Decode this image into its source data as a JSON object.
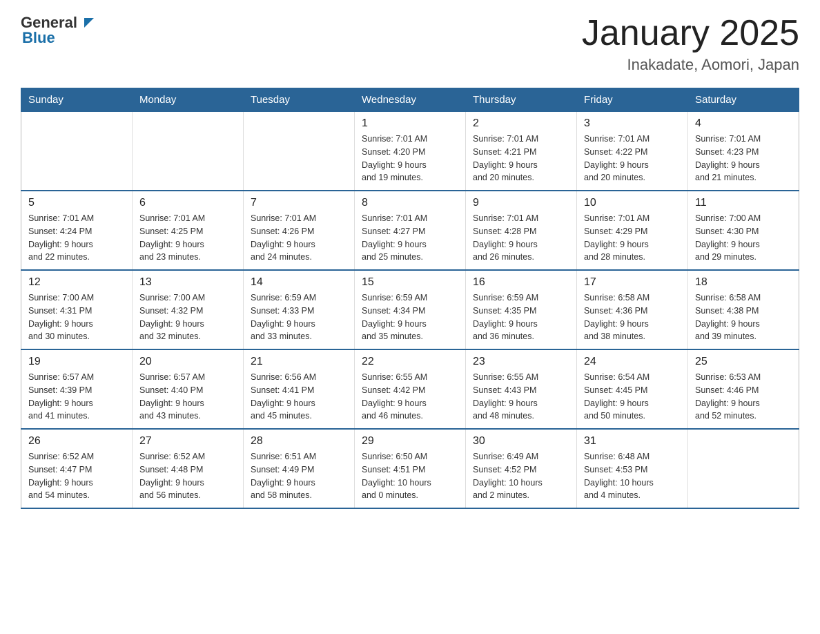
{
  "header": {
    "logo_general": "General",
    "logo_blue": "Blue",
    "title": "January 2025",
    "subtitle": "Inakadate, Aomori, Japan"
  },
  "weekdays": [
    "Sunday",
    "Monday",
    "Tuesday",
    "Wednesday",
    "Thursday",
    "Friday",
    "Saturday"
  ],
  "weeks": [
    [
      {
        "day": "",
        "info": ""
      },
      {
        "day": "",
        "info": ""
      },
      {
        "day": "",
        "info": ""
      },
      {
        "day": "1",
        "info": "Sunrise: 7:01 AM\nSunset: 4:20 PM\nDaylight: 9 hours\nand 19 minutes."
      },
      {
        "day": "2",
        "info": "Sunrise: 7:01 AM\nSunset: 4:21 PM\nDaylight: 9 hours\nand 20 minutes."
      },
      {
        "day": "3",
        "info": "Sunrise: 7:01 AM\nSunset: 4:22 PM\nDaylight: 9 hours\nand 20 minutes."
      },
      {
        "day": "4",
        "info": "Sunrise: 7:01 AM\nSunset: 4:23 PM\nDaylight: 9 hours\nand 21 minutes."
      }
    ],
    [
      {
        "day": "5",
        "info": "Sunrise: 7:01 AM\nSunset: 4:24 PM\nDaylight: 9 hours\nand 22 minutes."
      },
      {
        "day": "6",
        "info": "Sunrise: 7:01 AM\nSunset: 4:25 PM\nDaylight: 9 hours\nand 23 minutes."
      },
      {
        "day": "7",
        "info": "Sunrise: 7:01 AM\nSunset: 4:26 PM\nDaylight: 9 hours\nand 24 minutes."
      },
      {
        "day": "8",
        "info": "Sunrise: 7:01 AM\nSunset: 4:27 PM\nDaylight: 9 hours\nand 25 minutes."
      },
      {
        "day": "9",
        "info": "Sunrise: 7:01 AM\nSunset: 4:28 PM\nDaylight: 9 hours\nand 26 minutes."
      },
      {
        "day": "10",
        "info": "Sunrise: 7:01 AM\nSunset: 4:29 PM\nDaylight: 9 hours\nand 28 minutes."
      },
      {
        "day": "11",
        "info": "Sunrise: 7:00 AM\nSunset: 4:30 PM\nDaylight: 9 hours\nand 29 minutes."
      }
    ],
    [
      {
        "day": "12",
        "info": "Sunrise: 7:00 AM\nSunset: 4:31 PM\nDaylight: 9 hours\nand 30 minutes."
      },
      {
        "day": "13",
        "info": "Sunrise: 7:00 AM\nSunset: 4:32 PM\nDaylight: 9 hours\nand 32 minutes."
      },
      {
        "day": "14",
        "info": "Sunrise: 6:59 AM\nSunset: 4:33 PM\nDaylight: 9 hours\nand 33 minutes."
      },
      {
        "day": "15",
        "info": "Sunrise: 6:59 AM\nSunset: 4:34 PM\nDaylight: 9 hours\nand 35 minutes."
      },
      {
        "day": "16",
        "info": "Sunrise: 6:59 AM\nSunset: 4:35 PM\nDaylight: 9 hours\nand 36 minutes."
      },
      {
        "day": "17",
        "info": "Sunrise: 6:58 AM\nSunset: 4:36 PM\nDaylight: 9 hours\nand 38 minutes."
      },
      {
        "day": "18",
        "info": "Sunrise: 6:58 AM\nSunset: 4:38 PM\nDaylight: 9 hours\nand 39 minutes."
      }
    ],
    [
      {
        "day": "19",
        "info": "Sunrise: 6:57 AM\nSunset: 4:39 PM\nDaylight: 9 hours\nand 41 minutes."
      },
      {
        "day": "20",
        "info": "Sunrise: 6:57 AM\nSunset: 4:40 PM\nDaylight: 9 hours\nand 43 minutes."
      },
      {
        "day": "21",
        "info": "Sunrise: 6:56 AM\nSunset: 4:41 PM\nDaylight: 9 hours\nand 45 minutes."
      },
      {
        "day": "22",
        "info": "Sunrise: 6:55 AM\nSunset: 4:42 PM\nDaylight: 9 hours\nand 46 minutes."
      },
      {
        "day": "23",
        "info": "Sunrise: 6:55 AM\nSunset: 4:43 PM\nDaylight: 9 hours\nand 48 minutes."
      },
      {
        "day": "24",
        "info": "Sunrise: 6:54 AM\nSunset: 4:45 PM\nDaylight: 9 hours\nand 50 minutes."
      },
      {
        "day": "25",
        "info": "Sunrise: 6:53 AM\nSunset: 4:46 PM\nDaylight: 9 hours\nand 52 minutes."
      }
    ],
    [
      {
        "day": "26",
        "info": "Sunrise: 6:52 AM\nSunset: 4:47 PM\nDaylight: 9 hours\nand 54 minutes."
      },
      {
        "day": "27",
        "info": "Sunrise: 6:52 AM\nSunset: 4:48 PM\nDaylight: 9 hours\nand 56 minutes."
      },
      {
        "day": "28",
        "info": "Sunrise: 6:51 AM\nSunset: 4:49 PM\nDaylight: 9 hours\nand 58 minutes."
      },
      {
        "day": "29",
        "info": "Sunrise: 6:50 AM\nSunset: 4:51 PM\nDaylight: 10 hours\nand 0 minutes."
      },
      {
        "day": "30",
        "info": "Sunrise: 6:49 AM\nSunset: 4:52 PM\nDaylight: 10 hours\nand 2 minutes."
      },
      {
        "day": "31",
        "info": "Sunrise: 6:48 AM\nSunset: 4:53 PM\nDaylight: 10 hours\nand 4 minutes."
      },
      {
        "day": "",
        "info": ""
      }
    ]
  ]
}
